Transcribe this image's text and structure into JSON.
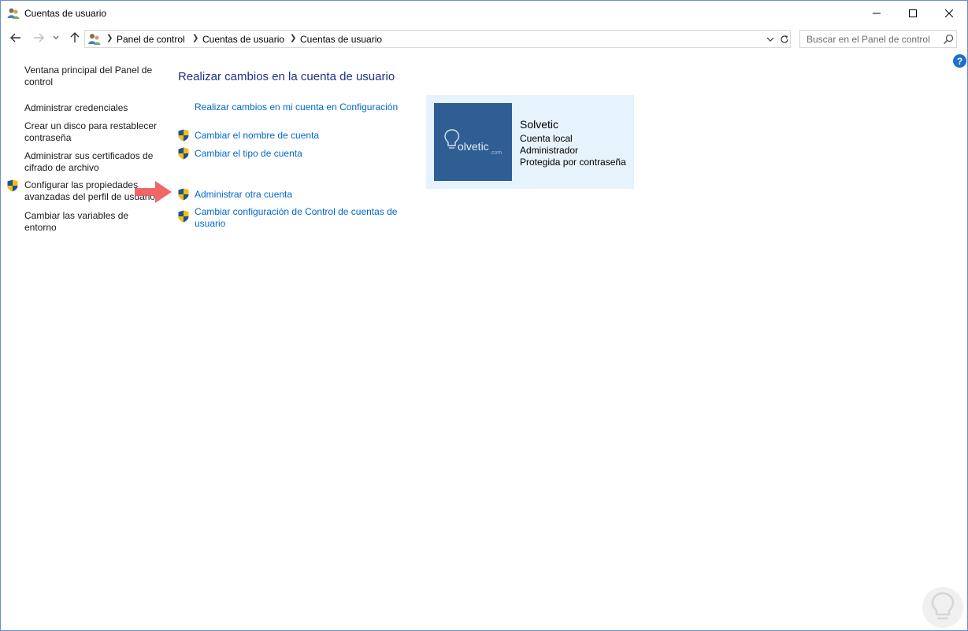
{
  "window": {
    "title": "Cuentas de usuario"
  },
  "address_bar": {
    "breadcrumb": [
      "Panel de control",
      "Cuentas de usuario",
      "Cuentas de usuario"
    ]
  },
  "search": {
    "placeholder": "Buscar en el Panel de control"
  },
  "help_label": "?",
  "sidebar": {
    "items": [
      {
        "label_1": "Ventana principal del Panel de",
        "label_2": "control"
      },
      {
        "label_1": "Administrar credenciales"
      },
      {
        "label_1": "Crear un disco para restablecer",
        "label_2": "contraseña"
      },
      {
        "label_1": "Administrar sus certificados de",
        "label_2": "cifrado de archivo"
      },
      {
        "label_1": "Configurar las propiedades",
        "label_2": "avanzadas del perfil de usuario"
      },
      {
        "label_1": "Cambiar las variables de",
        "label_2": "entorno"
      }
    ]
  },
  "main": {
    "title": "Realizar cambios en la cuenta de usuario",
    "links": [
      {
        "label_1": "Realizar cambios en mi cuenta en Configuración"
      },
      {
        "label_1": "Cambiar el nombre de cuenta"
      },
      {
        "label_1": "Cambiar el tipo de cuenta"
      },
      {
        "label_1": "Administrar otra cuenta"
      },
      {
        "label_1": "Cambiar configuración de Control de cuentas de",
        "label_2": "usuario"
      }
    ]
  },
  "account": {
    "avatar_text": "olvetic",
    "avatar_suffix": ".com",
    "name": "Solvetic",
    "type": "Cuenta local",
    "role": "Administrador",
    "protection": "Protegida por contraseña"
  },
  "colors": {
    "link": "#0066cc",
    "heading": "#1e3287",
    "card_bg": "#e6f2fc",
    "avatar_bg": "#2f5e94",
    "arrow": "#f0595a"
  }
}
